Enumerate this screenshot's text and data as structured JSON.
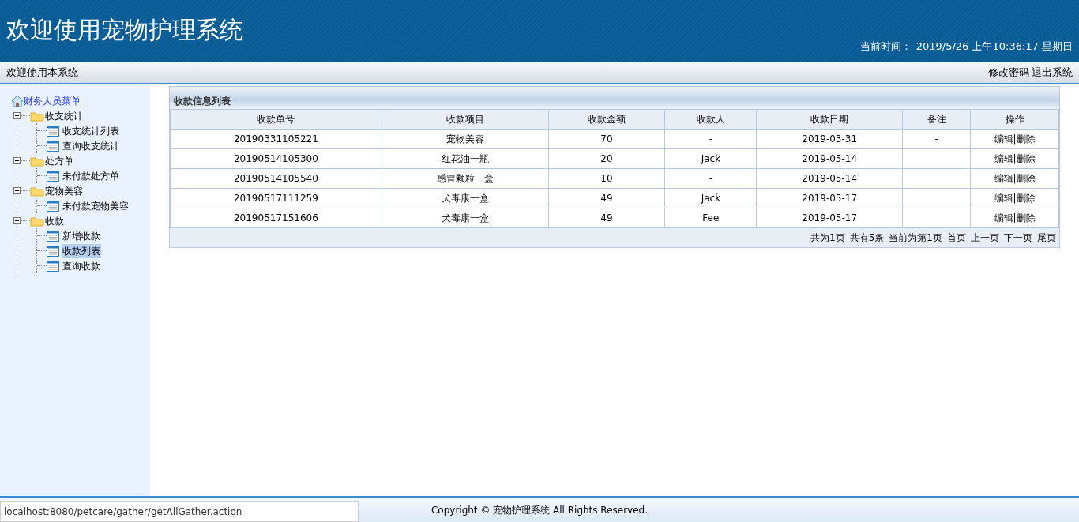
{
  "header": {
    "title": "欢迎使用宠物护理系统",
    "time_label": "当前时间：",
    "time_value": "2019/5/26 上午10:36:17 星期日"
  },
  "top_bar": {
    "welcome": "欢迎使用本系统",
    "links": [
      "修改密码",
      "退出系统"
    ]
  },
  "sidebar": {
    "root": "财务人员菜单",
    "groups": [
      {
        "label": "收支统计",
        "expanded": true,
        "children": [
          {
            "label": "收支统计列表",
            "selected": false
          },
          {
            "label": "查询收支统计",
            "selected": false
          }
        ]
      },
      {
        "label": "处方单",
        "expanded": true,
        "children": [
          {
            "label": "未付款处方单",
            "selected": false
          }
        ]
      },
      {
        "label": "宠物美容",
        "expanded": true,
        "children": [
          {
            "label": "未付款宠物美容",
            "selected": false
          }
        ]
      },
      {
        "label": "收款",
        "expanded": true,
        "children": [
          {
            "label": "新增收款",
            "selected": false
          },
          {
            "label": "收款列表",
            "selected": true
          },
          {
            "label": "查询收款",
            "selected": false
          }
        ]
      }
    ]
  },
  "panel": {
    "title": "收款信息列表"
  },
  "table": {
    "columns": [
      "收款单号",
      "收款项目",
      "收款金额",
      "收款人",
      "收款日期",
      "备注",
      "操作"
    ],
    "action_separator": "|",
    "rows": [
      {
        "cells": [
          "20190331105221",
          "宠物美容",
          "70",
          "-",
          "2019-03-31",
          "-"
        ],
        "actions": [
          "编辑",
          "删除"
        ]
      },
      {
        "cells": [
          "20190514105300",
          "红花油一瓶",
          "20",
          "Jack",
          "2019-05-14",
          ""
        ],
        "actions": [
          "编辑",
          "删除"
        ]
      },
      {
        "cells": [
          "20190514105540",
          "感冒颗粒一盒",
          "10",
          "-",
          "2019-05-14",
          ""
        ],
        "actions": [
          "编辑",
          "删除"
        ]
      },
      {
        "cells": [
          "20190517111259",
          "犬毒康一盒",
          "49",
          "Jack",
          "2019-05-17",
          ""
        ],
        "actions": [
          "编辑",
          "删除"
        ]
      },
      {
        "cells": [
          "20190517151606",
          "犬毒康一盒",
          "49",
          "Fee",
          "2019-05-17",
          ""
        ],
        "actions": [
          "编辑",
          "删除"
        ]
      }
    ]
  },
  "pagination": {
    "info": [
      "共为1页",
      "共有5条",
      "当前为第1页"
    ],
    "links": [
      "首页",
      "上一页",
      "下一页",
      "尾页"
    ]
  },
  "footer": {
    "copyright": "Copyright © 宠物护理系统 All Rights Reserved."
  },
  "status_url": "localhost:8080/petcare/gather/getAllGather.action"
}
